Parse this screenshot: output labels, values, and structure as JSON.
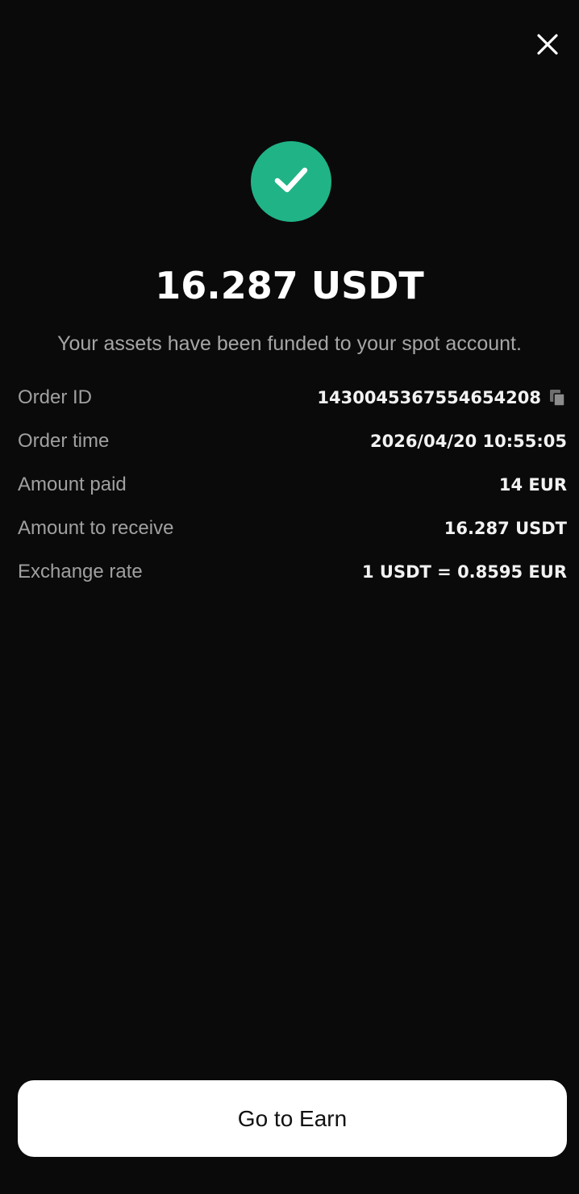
{
  "header": {
    "close_icon": "close-icon"
  },
  "status": {
    "icon": "check-icon",
    "color": "#20b386"
  },
  "summary": {
    "amount": "16.287 USDT",
    "message": "Your assets have been funded to your spot account."
  },
  "details": [
    {
      "label": "Order ID",
      "value": "1430045367554654208",
      "icon": "copy-icon"
    },
    {
      "label": "Order time",
      "value": "2026/04/20 10:55:05"
    },
    {
      "label": "Amount paid",
      "value": "14 EUR"
    },
    {
      "label": "Amount to receive",
      "value": "16.287 USDT"
    },
    {
      "label": "Exchange rate",
      "value": "1 USDT = 0.8595 EUR"
    }
  ],
  "footer": {
    "button_label": "Go to Earn"
  },
  "colors": {
    "background": "#0a0a0a",
    "accent": "#20b386",
    "label": "#a0a0a0"
  }
}
